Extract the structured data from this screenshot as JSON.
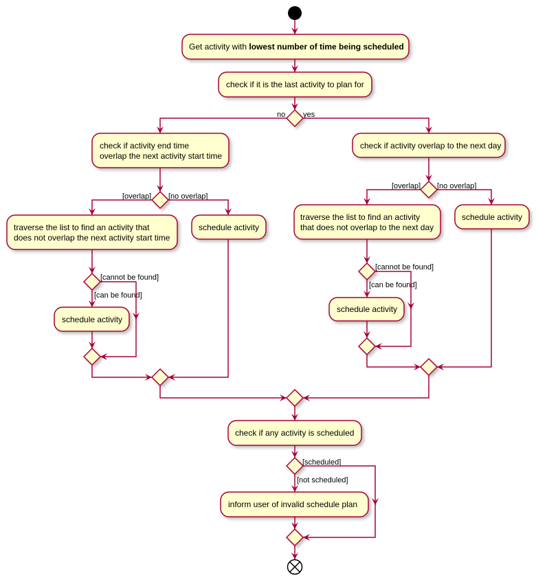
{
  "colors": {
    "stroke": "#A80036",
    "fill": "#FEFECE",
    "start": "#000000"
  },
  "nodes": {
    "get_activity": {
      "prefix": "Get activity with ",
      "bold": "lowest number of time being scheduled"
    },
    "check_last": "check if it is the last activity to plan for",
    "check_end_overlap": [
      "check if activity end time",
      "overlap the next activity start time"
    ],
    "traverse_left": [
      "traverse the list to find an activity that",
      "does not overlap the next activity start time"
    ],
    "schedule_left_inner": "schedule activity",
    "schedule_left_outer": "schedule activity",
    "check_next_day": "check if activity overlap to the next day",
    "traverse_right": [
      "traverse the list to find an activity",
      "that does not overlap to the next day"
    ],
    "schedule_right_inner": "schedule activity",
    "schedule_right_outer": "schedule activity",
    "check_any": "check if any activity is scheduled",
    "inform_user": "inform user of invalid schedule plan"
  },
  "guards": {
    "no": "no",
    "yes": "yes",
    "left_overlap": "[overlap]",
    "left_no_overlap": "[no overlap]",
    "left_cannot": "[cannot be found]",
    "left_can": "[can be found]",
    "right_overlap": "[overlap]",
    "right_no_overlap": "[no overlap]",
    "right_cannot": "[cannot be found]",
    "right_can": "[can be found]",
    "scheduled": "[scheduled]",
    "not_scheduled": "[not scheduled]"
  }
}
